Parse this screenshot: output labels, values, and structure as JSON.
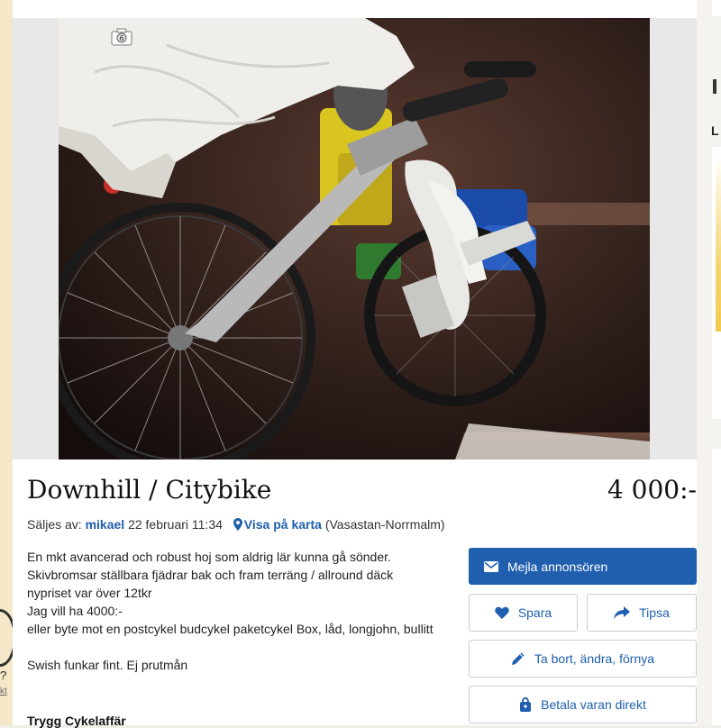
{
  "listing": {
    "title": "Downhill / Citybike",
    "price": "4 000:-",
    "seller_prefix": "Säljes av:",
    "seller_name": "mikael",
    "date": "22 februari 11:34",
    "map_link": "Visa på karta",
    "location": "(Vasastan-Norrmalm)",
    "description": [
      "En mkt avancerad och robust hoj som aldrig lär kunna gå sönder.",
      "Skivbromsar ställbara fjädrar bak och fram terräng / allround däck",
      "nypriset var över 12tkr",
      "Jag vill ha 4000:-",
      "eller byte mot en postcykel budcykel paketcykel Box, låd, longjohn, bullitt",
      "",
      "Swish funkar fint. Ej prutmån"
    ],
    "shop_heading": "Trygg Cykelaffär"
  },
  "actions": {
    "email": "Mejla annonsören",
    "save": "Spara",
    "tip": "Tipsa",
    "edit": "Ta bort, ändra, förnya",
    "pay": "Betala varan direkt"
  },
  "photo": {
    "count_badge": "6"
  },
  "sidebar": {
    "cut_letter": "L"
  },
  "left_strip": {
    "question_mark": "?",
    "link_fragment": "kt"
  },
  "colors": {
    "primary": "#1f5fae",
    "left_strip": "#f5e8c8",
    "page_bg": "#f0efe9"
  }
}
